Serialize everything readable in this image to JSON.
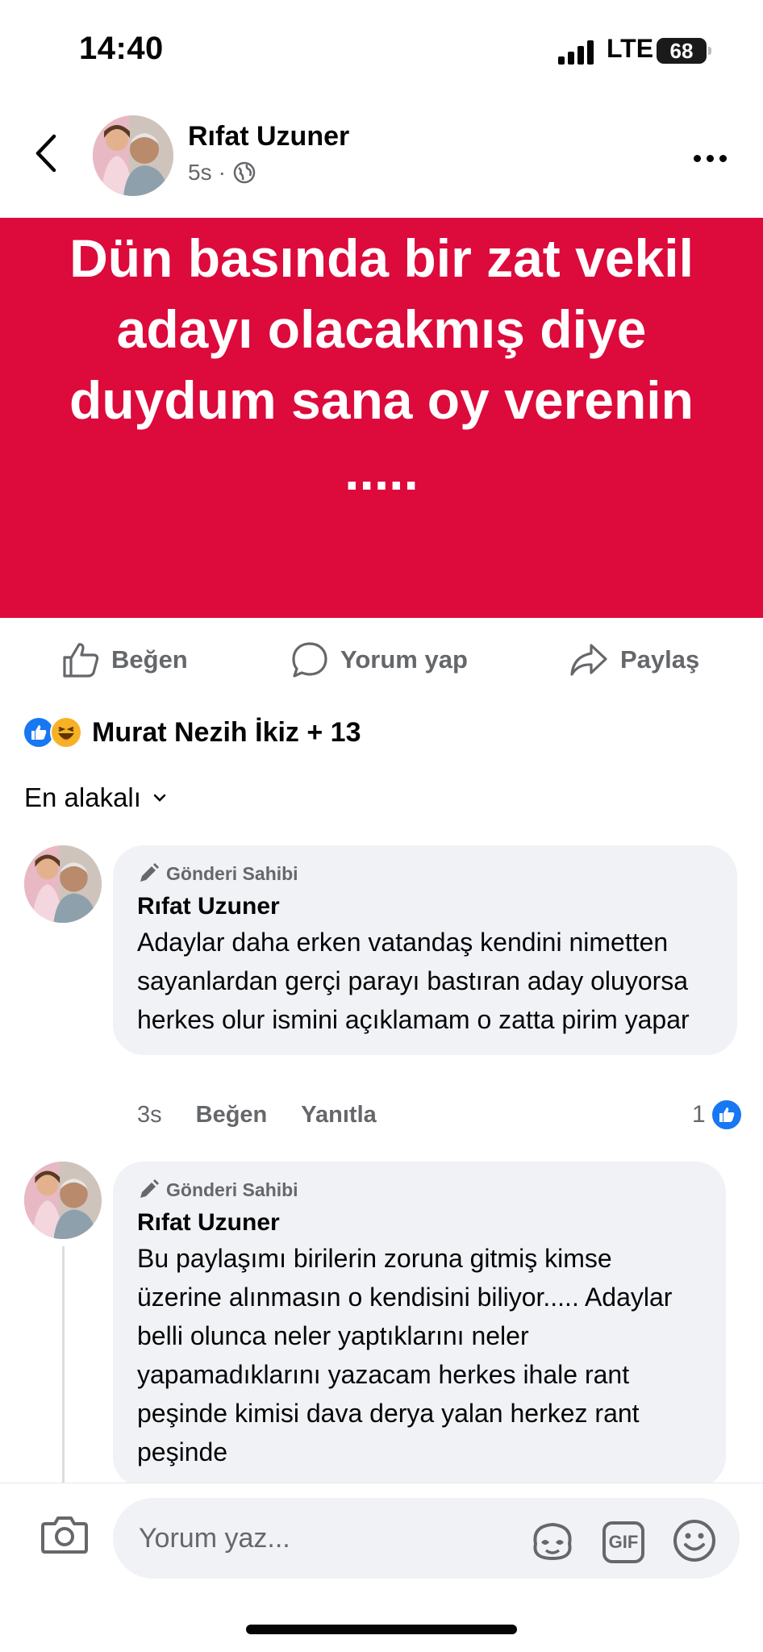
{
  "status_bar": {
    "time": "14:40",
    "network": "LTE",
    "battery": "68"
  },
  "post": {
    "author": "Rıfat Uzuner",
    "time": "5s",
    "separator": "·",
    "text": "Dün basında bir zat vekil adayı olacakmış diye duydum sana oy verenin .....",
    "background_color": "#dd0a3c"
  },
  "actions": {
    "like": "Beğen",
    "comment": "Yorum yap",
    "share": "Paylaş"
  },
  "reactions": {
    "summary": "Murat Nezih İkiz + 13"
  },
  "sort": {
    "label": "En alakalı"
  },
  "comments": [
    {
      "badge": "Gönderi Sahibi",
      "author": "Rıfat Uzuner",
      "text": "Adaylar daha erken vatandaş kendini nimetten sayanlardan gerçi parayı bastıran aday oluyorsa herkes olur ismini açıklamam o zatta pirim yapar",
      "time": "3s",
      "like": "Beğen",
      "reply": "Yanıtla",
      "like_count": "1"
    },
    {
      "badge": "Gönderi Sahibi",
      "author": "Rıfat Uzuner",
      "text": "Bu paylaşımı birilerin zoruna gitmiş kimse üzerine alınmasın o kendisini biliyor..... Adaylar belli olunca neler yaptıklarını neler yapamadıklarını yazacam herkes ihale rant peşinde kimisi dava derya yalan herkez rant peşinde"
    }
  ],
  "composer": {
    "placeholder": "Yorum yaz...",
    "gif_label": "GIF"
  }
}
